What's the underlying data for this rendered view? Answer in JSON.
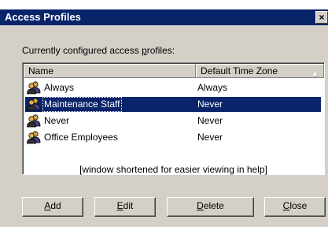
{
  "window": {
    "title": "Access Profiles",
    "close_glyph": "×"
  },
  "caption": {
    "prefix": "Currently configured access ",
    "accel": "p",
    "suffix": "rofiles:"
  },
  "list": {
    "columns": [
      "Name",
      "Default Time Zone"
    ],
    "sort_glyph": "▲",
    "rows": [
      {
        "name": "Always",
        "tz": "Always",
        "selected": false
      },
      {
        "name": "Maintenance Staff",
        "tz": "Never",
        "selected": true
      },
      {
        "name": "Never",
        "tz": "Never",
        "selected": false
      },
      {
        "name": "Office Employees",
        "tz": "Never",
        "selected": false
      }
    ],
    "row_icon": "users-group-icon",
    "note": "[window shortened for easier viewing in help]"
  },
  "buttons": {
    "add": {
      "accel": "A",
      "rest": "dd"
    },
    "edit": {
      "accel": "E",
      "rest": "dit"
    },
    "delete": {
      "accel": "D",
      "rest": "elete"
    },
    "close": {
      "accel": "C",
      "rest": "lose"
    }
  },
  "colors": {
    "titlebar": "#0a246a",
    "selection": "#0a246a",
    "face": "#d4d0c8"
  }
}
